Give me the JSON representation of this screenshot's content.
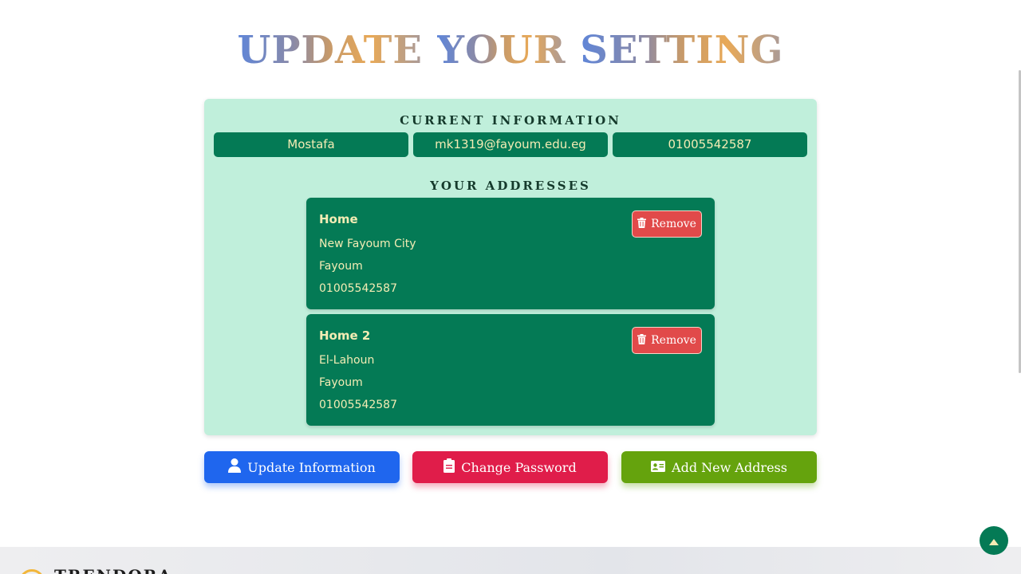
{
  "title": {
    "part1": "UPDATE",
    "part2": "YOUR",
    "part3": "SETTING"
  },
  "current_information": {
    "heading": "CURRENT INFORMATION",
    "name": "Mostafa",
    "email": "mk1319@fayoum.edu.eg",
    "phone": "01005542587"
  },
  "addresses": {
    "heading": "YOUR ADDRESSES",
    "items": [
      {
        "name": "Home",
        "street": "New Fayoum City",
        "city": "Fayoum",
        "phone": "01005542587",
        "remove_label": "Remove"
      },
      {
        "name": "Home 2",
        "street": "El-Lahoun",
        "city": "Fayoum",
        "phone": "01005542587",
        "remove_label": "Remove"
      }
    ]
  },
  "actions": {
    "update_information": "Update Information",
    "change_password": "Change Password",
    "add_new_address": "Add New Address"
  },
  "footer": {
    "brand": "TRENDORA"
  },
  "colors": {
    "card_background": "#c0efdb",
    "primary_green": "#047a55",
    "text_cream": "#f3ecb4",
    "remove_red": "#e14a4a",
    "update_blue": "#1f66ee",
    "password_red": "#e01d4a",
    "address_green": "#65a30d"
  },
  "icons": {
    "remove": "trash-icon",
    "update_information": "user-icon",
    "change_password": "clipboard-icon",
    "add_new_address": "id-card-icon",
    "scroll_top": "caret-up-icon"
  }
}
